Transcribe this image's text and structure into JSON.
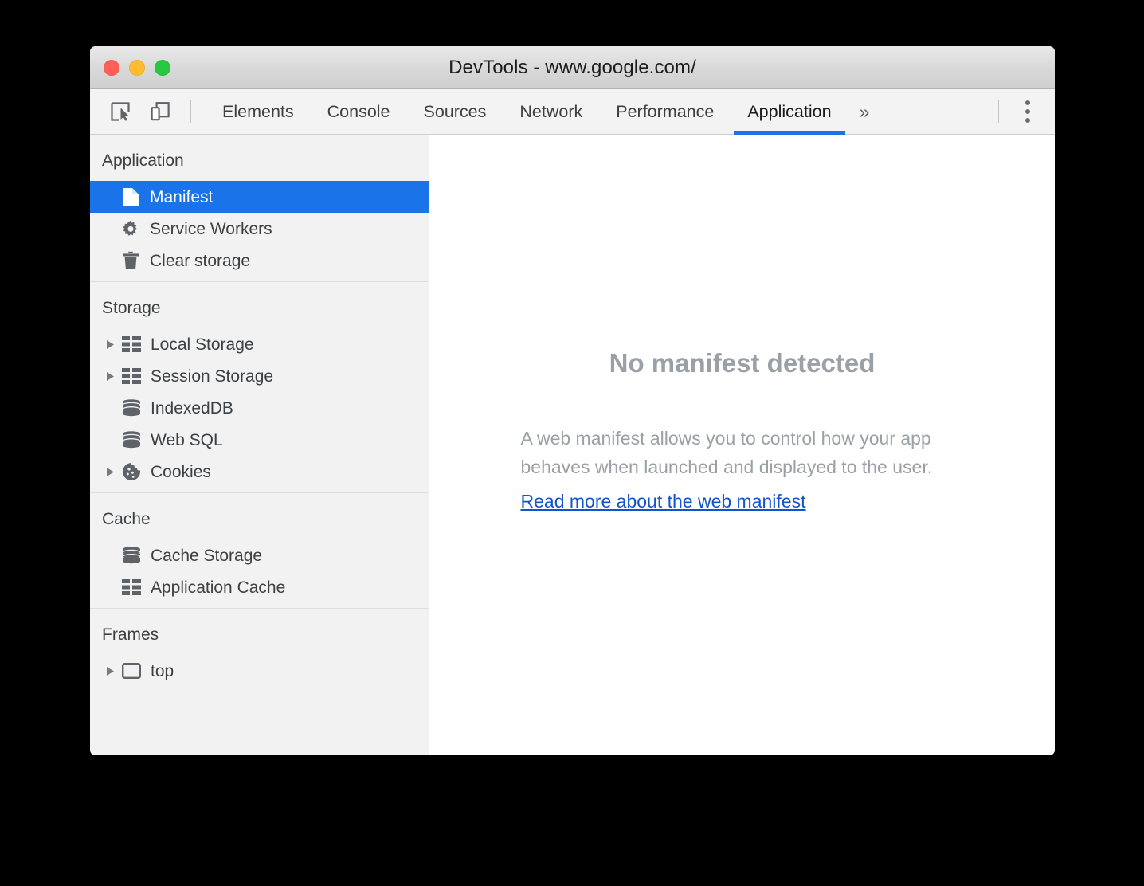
{
  "window": {
    "title": "DevTools - www.google.com/",
    "traffic_lights": [
      {
        "name": "close",
        "color": "#ff5f57"
      },
      {
        "name": "minimize",
        "color": "#febc2e"
      },
      {
        "name": "maximize",
        "color": "#28c840"
      }
    ]
  },
  "toolbar": {
    "inspect_icon": "inspect-element-icon",
    "device_icon": "device-toolbar-icon",
    "overflow_label": "»",
    "kebab_icon": "more-options-icon",
    "tabs": [
      {
        "label": "Elements",
        "active": false
      },
      {
        "label": "Console",
        "active": false
      },
      {
        "label": "Sources",
        "active": false
      },
      {
        "label": "Network",
        "active": false
      },
      {
        "label": "Performance",
        "active": false
      },
      {
        "label": "Application",
        "active": true
      }
    ],
    "active_tab": "Application",
    "accent_color": "#1a73e8"
  },
  "sidebar": {
    "sections": [
      {
        "title": "Application",
        "items": [
          {
            "label": "Manifest",
            "icon": "document-icon",
            "selected": true,
            "expandable": false
          },
          {
            "label": "Service Workers",
            "icon": "gear-icon",
            "selected": false,
            "expandable": false
          },
          {
            "label": "Clear storage",
            "icon": "trash-icon",
            "selected": false,
            "expandable": false
          }
        ]
      },
      {
        "title": "Storage",
        "items": [
          {
            "label": "Local Storage",
            "icon": "table-icon",
            "selected": false,
            "expandable": true
          },
          {
            "label": "Session Storage",
            "icon": "table-icon",
            "selected": false,
            "expandable": true
          },
          {
            "label": "IndexedDB",
            "icon": "database-icon",
            "selected": false,
            "expandable": false
          },
          {
            "label": "Web SQL",
            "icon": "database-icon",
            "selected": false,
            "expandable": false
          },
          {
            "label": "Cookies",
            "icon": "cookie-icon",
            "selected": false,
            "expandable": true
          }
        ]
      },
      {
        "title": "Cache",
        "items": [
          {
            "label": "Cache Storage",
            "icon": "database-icon",
            "selected": false,
            "expandable": false
          },
          {
            "label": "Application Cache",
            "icon": "table-icon",
            "selected": false,
            "expandable": false
          }
        ]
      },
      {
        "title": "Frames",
        "items": [
          {
            "label": "top",
            "icon": "frame-icon",
            "selected": false,
            "expandable": true
          }
        ]
      }
    ]
  },
  "main": {
    "heading": "No manifest detected",
    "description": "A web manifest allows you to control how your app behaves when launched and displayed to the user.",
    "link_text": "Read more about the web manifest",
    "link_color": "#1155cc",
    "muted_color": "#9aa0a6"
  }
}
